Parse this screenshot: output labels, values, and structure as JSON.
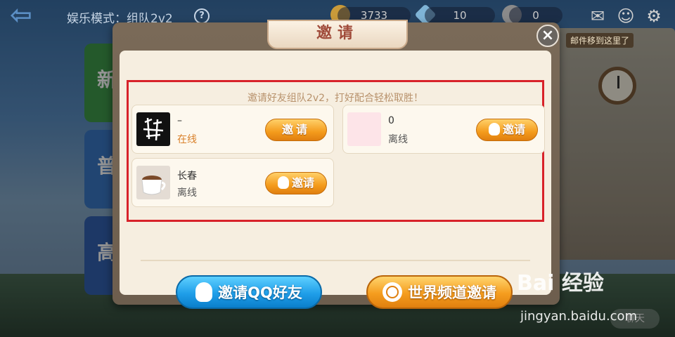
{
  "topbar": {
    "mode_title": "娱乐模式：组队2v2",
    "help": "?",
    "gold": "3733",
    "diamonds": "10",
    "coupons": "0",
    "mail_tip": "邮件移到这里了"
  },
  "background": {
    "left_tabs": [
      "新",
      "普",
      "高"
    ],
    "chat_label": "聊天"
  },
  "dialog": {
    "title": "邀请",
    "close": "×",
    "hint": "邀请好友组队2v2，打好配合轻松取胜！",
    "friends": [
      {
        "name": "–",
        "status": "在线",
        "button": "邀请"
      },
      {
        "name": "0",
        "status": "离线",
        "button": "邀请"
      },
      {
        "name": "长春",
        "status": "离线",
        "button": "邀请"
      }
    ],
    "invite_qq": "邀请QQ好友",
    "invite_world": "世界频道邀请"
  },
  "watermark": {
    "brand": "Bai 经验",
    "url": "jingyan.baidu.com"
  },
  "colors": {
    "highlight_box": "#d8222a",
    "online": "#d9812b",
    "qq_button": "#1f9ee9",
    "world_button": "#f59d1e"
  }
}
